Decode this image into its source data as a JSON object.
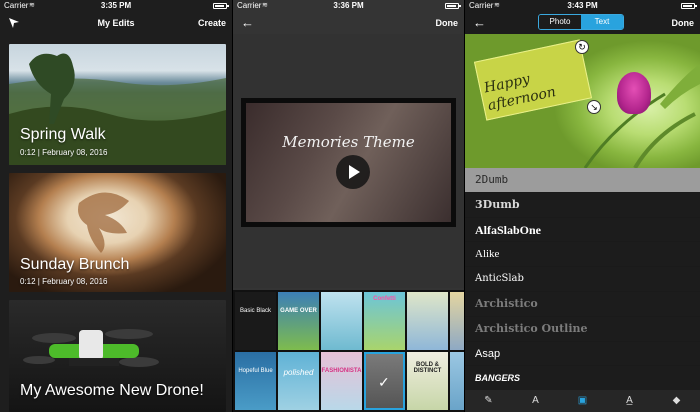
{
  "panel1": {
    "status": {
      "carrier": "Carrier",
      "time": "3:35 PM"
    },
    "nav": {
      "title": "My Edits",
      "right": "Create"
    },
    "cards": [
      {
        "title": "Spring Walk",
        "meta": "0:12 | February 08, 2016"
      },
      {
        "title": "Sunday Brunch",
        "meta": "0:12 | February 08, 2016"
      },
      {
        "title": "My Awesome New Drone!",
        "meta": ""
      }
    ]
  },
  "panel2": {
    "status": {
      "carrier": "Carrier",
      "time": "3:36 PM"
    },
    "nav": {
      "right": "Done"
    },
    "video_title": "Memories Theme",
    "themes_row1": [
      "Basic Black",
      "GAME OVER",
      "",
      "Confetti",
      "",
      ""
    ],
    "themes_row2": [
      "Hopeful Blue",
      "polished",
      "FASHIONISTA",
      "",
      "BOLD & DISTINCT",
      ""
    ]
  },
  "panel3": {
    "status": {
      "carrier": "Carrier",
      "time": "3:43 PM"
    },
    "nav": {
      "right": "Done"
    },
    "segments": {
      "photo": "Photo",
      "text": "Text"
    },
    "overlay_text": "Happy afternoon",
    "fonts": [
      "2Dumb",
      "3Dumb",
      "AlfaSlabOne",
      "Alike",
      "AnticSlab",
      "Archistico",
      "Archistico Outline",
      "Asap",
      "BANGERS"
    ]
  },
  "colors": {
    "accent": "#29a3de",
    "selected_row": "#9c9c9c"
  }
}
